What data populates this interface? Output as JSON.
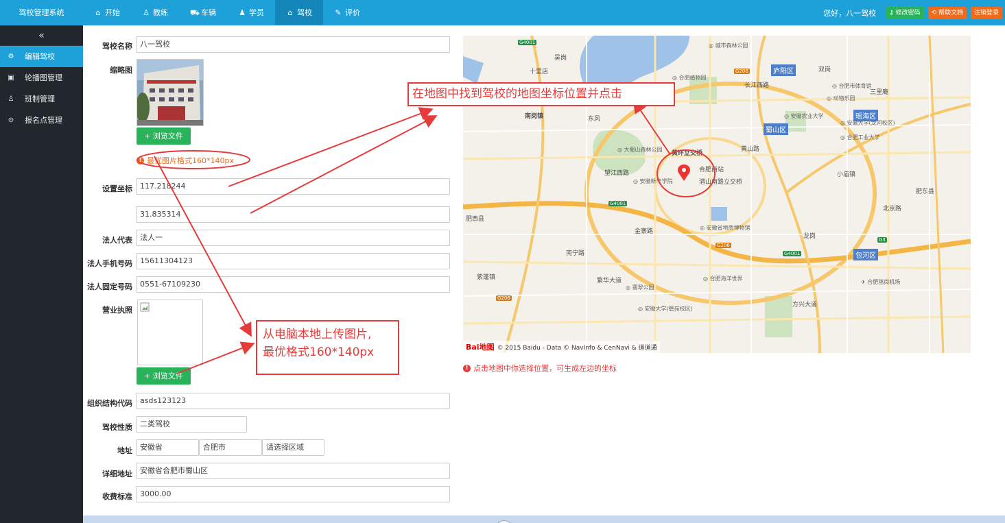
{
  "app": {
    "title": "驾校管理系统"
  },
  "nav": [
    {
      "label": "开始",
      "icon": "home-icon"
    },
    {
      "label": "教练",
      "icon": "user-icon"
    },
    {
      "label": "车辆",
      "icon": "car-icon"
    },
    {
      "label": "学员",
      "icon": "student-icon"
    },
    {
      "label": "驾校",
      "icon": "school-icon"
    },
    {
      "label": "评价",
      "icon": "comment-icon"
    }
  ],
  "header": {
    "greeting": "您好，八一驾校",
    "change_password": "修改密码",
    "help_doc": "帮助文档",
    "logout": "注销登录"
  },
  "sidebar": {
    "collapse_glyph": "«",
    "items": [
      {
        "label": "编辑驾校",
        "icon": "gear-icon"
      },
      {
        "label": "轮播图管理",
        "icon": "image-icon"
      },
      {
        "label": "班制管理",
        "icon": "class-icon"
      },
      {
        "label": "报名点管理",
        "icon": "location-icon"
      }
    ]
  },
  "form": {
    "school_name_label": "驾校名称",
    "school_name_value": "八一驾校",
    "thumbnail_label": "缩略图",
    "browse_label": "+ 浏览文件",
    "image_tip": "最优图片格式160*140px",
    "coords_label": "设置坐标",
    "longitude": "117.218244",
    "latitude": "31.835314",
    "legal_rep_label": "法人代表",
    "legal_rep_value": "法人一",
    "legal_phone_label": "法人手机号码",
    "legal_phone_value": "15611304123",
    "legal_tel_label": "法人固定号码",
    "legal_tel_value": "0551-67109230",
    "license_label": "营业执照",
    "org_code_label": "组织结构代码",
    "org_code_value": "asds123123",
    "nature_label": "驾校性质",
    "nature_value": "二类驾校",
    "address_label": "地址",
    "province": "安徽省",
    "city": "合肥市",
    "district": "请选择区域",
    "detail_address_label": "详细地址",
    "detail_address_value": "安徽省合肥市蜀山区",
    "fee_label": "收费标准",
    "fee_value": "3000.00"
  },
  "map": {
    "tip": "点击地图中你选择位置，可生成左边的坐标",
    "copyright": "© 2015 Baidu - Data © NavInfo & CenNavi & 道道通",
    "baidu_logo": "Bai地图",
    "districts": [
      "庐阳区",
      "蜀山区",
      "瑶海区",
      "包河区"
    ],
    "places": [
      "南岗镇",
      "吴岗",
      "黄环立交桥",
      "合肥西站",
      "潜山南路立交桥",
      "望江西路",
      "东风",
      "十里店",
      "黄山路",
      "长江西路",
      "双岗",
      "三里庵",
      "小庙镇",
      "肥东县",
      "龙岗",
      "北京路",
      "肥西县",
      "紫蓬镇",
      "方兴大道",
      "繁华大道",
      "金寨路",
      "南宁路"
    ],
    "pois": [
      "城市森林公园",
      "合肥植物园",
      "合肥市体育馆",
      "动物乐园",
      "安徽农业大学",
      "安徽大学(龙河校区)",
      "合肥工业大学",
      "大蜀山森林公园",
      "安徽新华学院",
      "安徽省地质博物馆",
      "翡翠公园",
      "合肥海洋世界",
      "合肥骆岗机场",
      "安徽大学(磬苑校区)"
    ],
    "roads": [
      "G4001",
      "G206",
      "G3"
    ]
  },
  "annotations": {
    "map_hint": "在地图中找到驾校的地图坐标位置并点击",
    "upload_hint_line1": "从电脑本地上传图片,",
    "upload_hint_line2": "最优格式160*140px"
  },
  "colors": {
    "topbar": "#1ea0d8",
    "sidebar": "#22272e",
    "green": "#28b25a",
    "orange": "#f26b1d",
    "annotation_red": "#e53b3b"
  }
}
